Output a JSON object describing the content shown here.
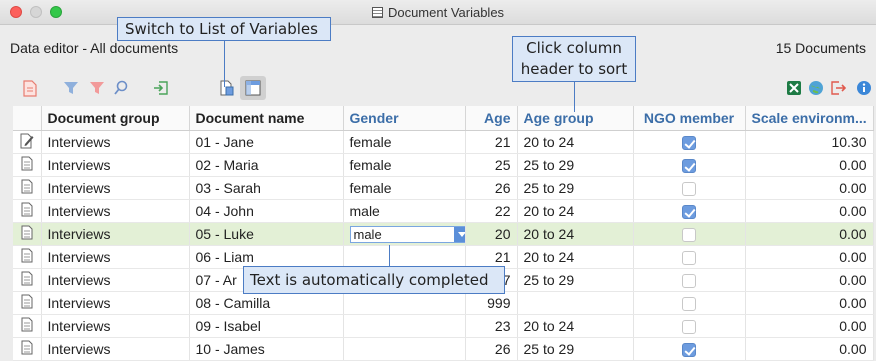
{
  "window": {
    "title": "Document Variables"
  },
  "header": {
    "subtitle": "Data editor - All documents",
    "count": "15 Documents"
  },
  "table": {
    "columns": [
      "Document group",
      "Document name",
      "Gender",
      "Age",
      "Age group",
      "NGO member",
      "Scale environm..."
    ],
    "rows": [
      {
        "group": "Interviews",
        "name": "01 - Jane",
        "gender": "female",
        "age": "21",
        "agegroup": "20 to 24",
        "ngo": true,
        "scale": "10.30"
      },
      {
        "group": "Interviews",
        "name": "02 - Maria",
        "gender": "female",
        "age": "25",
        "agegroup": "25 to 29",
        "ngo": true,
        "scale": "0.00"
      },
      {
        "group": "Interviews",
        "name": "03 - Sarah",
        "gender": "female",
        "age": "26",
        "agegroup": "25 to 29",
        "ngo": false,
        "scale": "0.00"
      },
      {
        "group": "Interviews",
        "name": "04 - John",
        "gender": "male",
        "age": "22",
        "agegroup": "20 to 24",
        "ngo": true,
        "scale": "0.00"
      },
      {
        "group": "Interviews",
        "name": "05 - Luke",
        "gender": "male",
        "age": "20",
        "agegroup": "20 to 24",
        "ngo": false,
        "scale": "0.00"
      },
      {
        "group": "Interviews",
        "name": "06 - Liam",
        "gender": "",
        "age": "21",
        "agegroup": "20 to 24",
        "ngo": false,
        "scale": "0.00"
      },
      {
        "group": "Interviews",
        "name": "07 - Ar",
        "gender": "",
        "age": "7",
        "agegroup": "25 to 29",
        "ngo": false,
        "scale": "0.00"
      },
      {
        "group": "Interviews",
        "name": "08 - Camilla",
        "gender": "",
        "age": "999",
        "agegroup": "",
        "ngo": false,
        "scale": "0.00"
      },
      {
        "group": "Interviews",
        "name": "09 - Isabel",
        "gender": "",
        "age": "23",
        "agegroup": "20 to 24",
        "ngo": false,
        "scale": "0.00"
      },
      {
        "group": "Interviews",
        "name": "10 - James",
        "gender": "",
        "age": "26",
        "agegroup": "25 to 29",
        "ngo": true,
        "scale": "0.00"
      }
    ]
  },
  "callouts": {
    "list_switch": "Switch to List of Variables",
    "sort_line1": "Click column",
    "sort_line2": "header to sort",
    "autocomplete": "Text is automatically completed"
  },
  "icons": [
    "document-icon",
    "filter-icon",
    "tag-filter-icon",
    "search-icon",
    "import-icon",
    "variable-list-icon",
    "table-view-icon",
    "excel-icon",
    "globe-icon",
    "export-icon",
    "info-icon",
    "edited-document-icon"
  ],
  "colors": {
    "accent": "#4c7cc4",
    "selected_row": "#e3f0d6",
    "header_highlight": "#3c6ea8"
  }
}
